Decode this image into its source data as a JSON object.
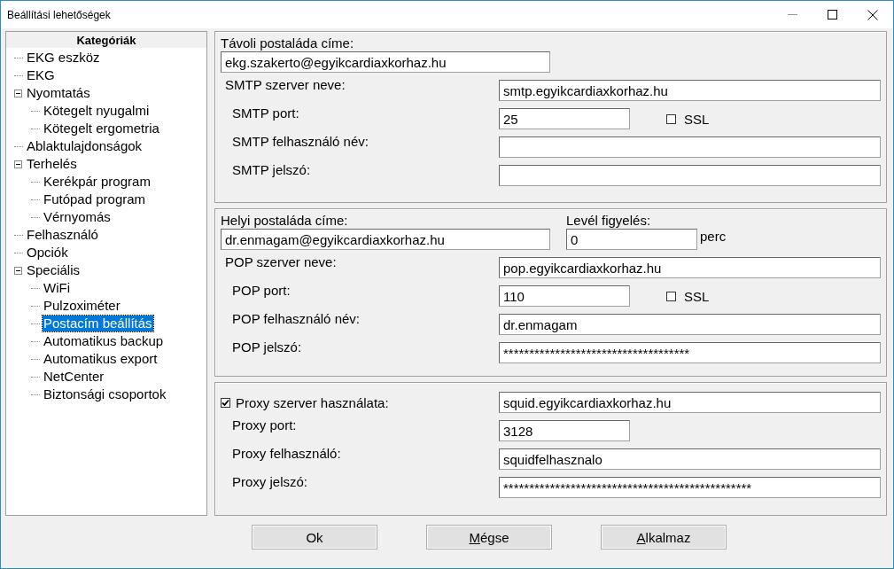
{
  "window": {
    "title": "Beállítási lehetőségek"
  },
  "sidebar": {
    "title": "Kategóriák",
    "items": [
      {
        "label": "EKG eszköz",
        "selected": false
      },
      {
        "label": "EKG",
        "selected": false
      },
      {
        "label": "Nyomtatás",
        "selected": false,
        "expanded": true,
        "children": [
          {
            "label": "Kötegelt nyugalmi",
            "selected": false
          },
          {
            "label": "Kötegelt ergometria",
            "selected": false
          }
        ]
      },
      {
        "label": "Ablaktulajdonságok",
        "selected": false
      },
      {
        "label": "Terhelés",
        "selected": false,
        "expanded": true,
        "children": [
          {
            "label": "Kerékpár program",
            "selected": false
          },
          {
            "label": "Futópad program",
            "selected": false
          },
          {
            "label": "Vérnyomás",
            "selected": false
          }
        ]
      },
      {
        "label": "Felhasználó",
        "selected": false
      },
      {
        "label": "Opciók",
        "selected": false
      },
      {
        "label": "Speciális",
        "selected": false,
        "expanded": true,
        "children": [
          {
            "label": "WiFi",
            "selected": false
          },
          {
            "label": "Pulzoximéter",
            "selected": false
          },
          {
            "label": "Postacím beállítás",
            "selected": true
          },
          {
            "label": "Automatikus backup",
            "selected": false
          },
          {
            "label": "Automatikus export",
            "selected": false
          },
          {
            "label": "NetCenter",
            "selected": false
          },
          {
            "label": "Biztonsági csoportok",
            "selected": false
          }
        ]
      }
    ]
  },
  "sections": [
    {
      "header": {
        "label": "Távoli postaláda címe:",
        "value": "ekg.szakerto@egyikcardiaxkorhaz.hu"
      },
      "rows": [
        {
          "kind": "field",
          "label": "SMTP szerver neve:",
          "value": "smtp.egyikcardiaxkorhaz.hu"
        },
        {
          "kind": "port",
          "label": "SMTP port:",
          "value": "25",
          "ssl": {
            "label": "SSL",
            "checked": false
          }
        },
        {
          "kind": "field",
          "label": "SMTP felhasználó név:",
          "value": ""
        },
        {
          "kind": "field",
          "label": "SMTP jelszó:",
          "value": ""
        }
      ]
    },
    {
      "header": {
        "label": "Helyi postaláda címe:",
        "value": "dr.enmagam@egyikcardiaxkorhaz.hu",
        "watch": {
          "label": "Levél figyelés:",
          "value": "0",
          "unit": "perc"
        }
      },
      "rows": [
        {
          "kind": "field",
          "label": "POP szerver neve:",
          "value": "pop.egyikcardiaxkorhaz.hu"
        },
        {
          "kind": "port",
          "label": "POP port:",
          "value": "110",
          "ssl": {
            "label": "SSL",
            "checked": false
          }
        },
        {
          "kind": "field",
          "label": "POP felhasználó név:",
          "value": "dr.enmagam"
        },
        {
          "kind": "field",
          "label": "POP jelszó:",
          "value": "************************************"
        }
      ]
    },
    {
      "rows": [
        {
          "kind": "check-field",
          "label": "Proxy szerver használata:",
          "checked": true,
          "value": "squid.egyikcardiaxkorhaz.hu"
        },
        {
          "kind": "short",
          "label": "Proxy port:",
          "value": "3128"
        },
        {
          "kind": "field",
          "label": "Proxy felhasználó:",
          "value": "squidfelhasznalo"
        },
        {
          "kind": "field",
          "label": "Proxy jelszó:",
          "value": "************************************************"
        }
      ]
    }
  ],
  "buttons": [
    {
      "label": "Ok",
      "mnemonic": false
    },
    {
      "label": "Mégse",
      "mnemonic": true
    },
    {
      "label": "Alkalmaz",
      "mnemonic": true
    }
  ]
}
